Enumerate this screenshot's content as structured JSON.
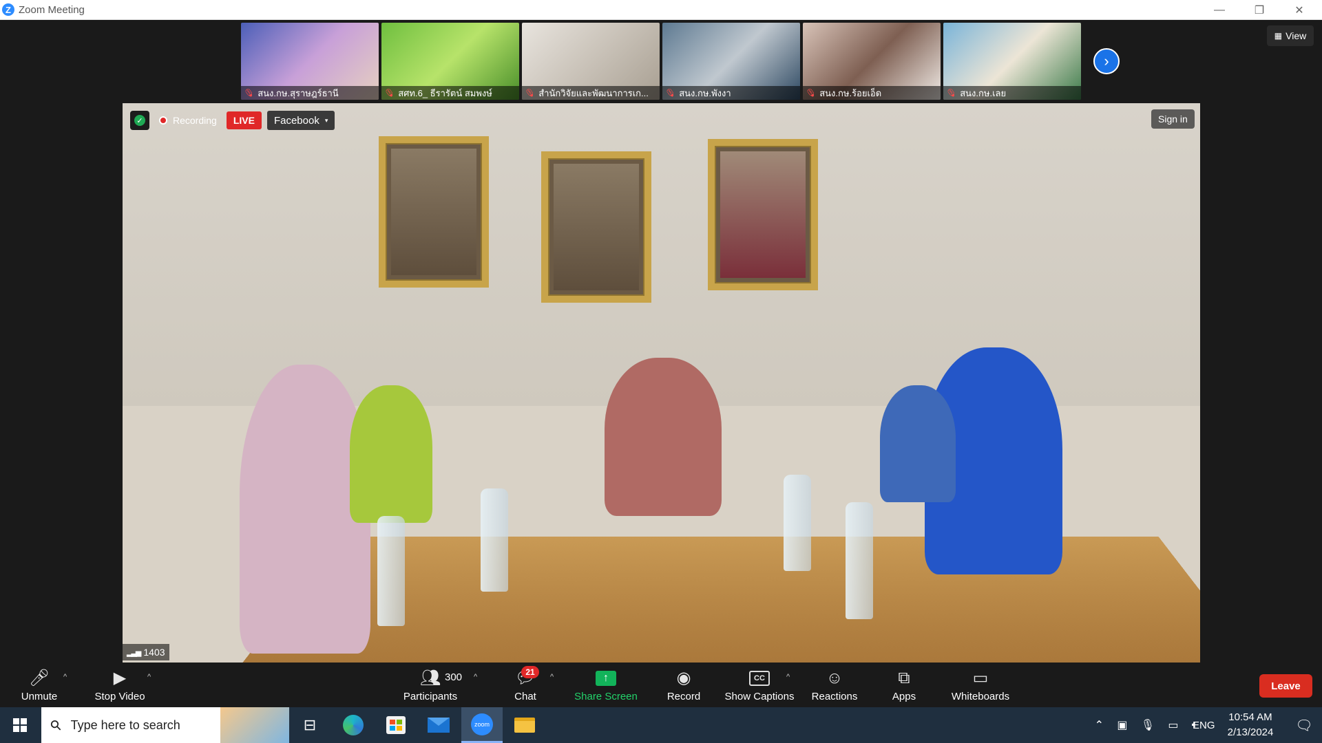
{
  "window": {
    "title": "Zoom Meeting",
    "logo_letter": "Z",
    "minimize": "—",
    "maximize": "❐",
    "close": "✕"
  },
  "thumbnails": [
    {
      "name": "สนง.กษ.สุราษฎร์ธานี",
      "colors": [
        "#4c5fb8",
        "#c8a0d8",
        "#e6d0c0"
      ]
    },
    {
      "name": "สศท.6_ ธีรารัตน์ สมพงษ์",
      "colors": [
        "#6fbf3f",
        "#b7e36a",
        "#4a8f2a"
      ]
    },
    {
      "name": "สำนักวิจัยและพัฒนาการเก...",
      "colors": [
        "#e8e4de",
        "#c9c2b8",
        "#a89f92"
      ]
    },
    {
      "name": "สนง.กษ.พังงา",
      "colors": [
        "#5e7a92",
        "#c0c8cf",
        "#2f4a63"
      ]
    },
    {
      "name": "สนง.กษ.ร้อยเอ็ด",
      "colors": [
        "#d8c3b8",
        "#7e5f52",
        "#efe9e4"
      ]
    },
    {
      "name": "สนง.กษ.เลย",
      "colors": [
        "#7ab4d8",
        "#ece5d6",
        "#3c7b4a"
      ]
    }
  ],
  "next_button": "›",
  "view_button": {
    "label": "View",
    "icon": "grid-icon"
  },
  "recording": {
    "label": "Recording",
    "live": "LIVE",
    "platform": "Facebook",
    "caret": "▾"
  },
  "sign_in": "Sign in",
  "viewer_count": "1403",
  "toolbar": {
    "unmute": {
      "label": "Unmute",
      "icon": "microphone-muted-icon"
    },
    "stop_video": {
      "label": "Stop Video",
      "icon": "video-camera-icon"
    },
    "participants": {
      "label": "Participants",
      "count": "300",
      "icon": "participants-icon"
    },
    "chat": {
      "label": "Chat",
      "badge": "21",
      "icon": "chat-bubble-icon"
    },
    "share_screen": {
      "label": "Share Screen",
      "icon": "share-arrow-icon"
    },
    "record": {
      "label": "Record",
      "icon": "record-circle-icon"
    },
    "show_captions": {
      "label": "Show Captions",
      "cc": "CC",
      "icon": "closed-captions-icon"
    },
    "reactions": {
      "label": "Reactions",
      "icon": "smiley-plus-icon"
    },
    "apps": {
      "label": "Apps",
      "icon": "apps-icon"
    },
    "whiteboards": {
      "label": "Whiteboards",
      "icon": "whiteboard-icon"
    },
    "leave": "Leave",
    "caret": "^"
  },
  "taskbar": {
    "search_placeholder": "Type here to search",
    "language": "ENG",
    "time": "10:54 AM",
    "date": "2/13/2024"
  },
  "colors": {
    "accent": "#2d8cff",
    "live": "#e02828",
    "share": "#12b35a",
    "leave": "#d92d20"
  }
}
